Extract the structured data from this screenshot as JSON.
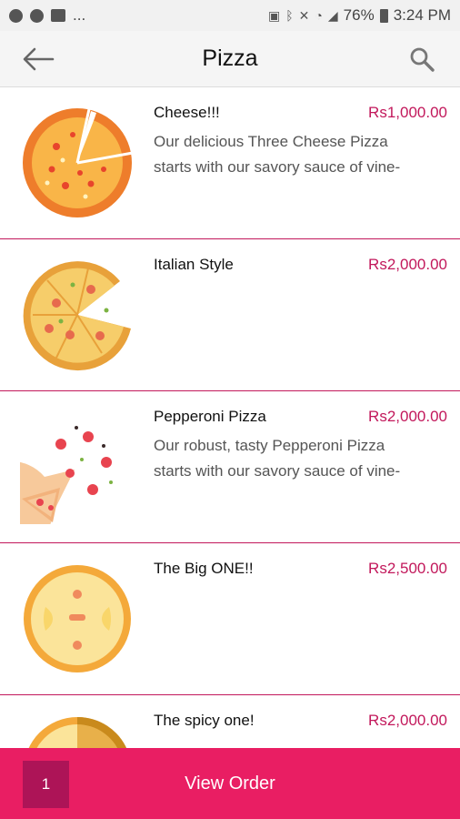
{
  "status_bar": {
    "ellipsis": "...",
    "battery_percent": "76%",
    "time": "3:24 PM"
  },
  "toolbar": {
    "title": "Pizza",
    "back_icon": "arrow-left-icon",
    "search_icon": "search-icon"
  },
  "items": [
    {
      "name": "Cheese!!!",
      "price": "Rs1,000.00",
      "desc_line1": "Our delicious Three Cheese Pizza",
      "desc_line2": "starts with our savory sauce of vine-",
      "icon": "cheese-pizza-icon"
    },
    {
      "name": "Italian Style",
      "price": "Rs2,000.00",
      "desc_line1": "",
      "desc_line2": "",
      "icon": "italian-pizza-icon"
    },
    {
      "name": "Pepperoni Pizza",
      "price": "Rs2,000.00",
      "desc_line1": "Our robust, tasty Pepperoni Pizza",
      "desc_line2": "starts with our savory sauce of vine-",
      "icon": "pepperoni-pizza-icon"
    },
    {
      "name": "The Big ONE!!",
      "price": "Rs2,500.00",
      "desc_line1": "",
      "desc_line2": "",
      "icon": "big-pizza-icon"
    },
    {
      "name": "The spicy one!",
      "price": "Rs2,000.00",
      "desc_line1": "",
      "desc_line2": "",
      "icon": "spicy-pizza-icon"
    }
  ],
  "order_bar": {
    "quantity": "1",
    "label": "View Order"
  },
  "colors": {
    "accent": "#e91e63",
    "accent_dark": "#ad1457",
    "price": "#c2185b"
  }
}
